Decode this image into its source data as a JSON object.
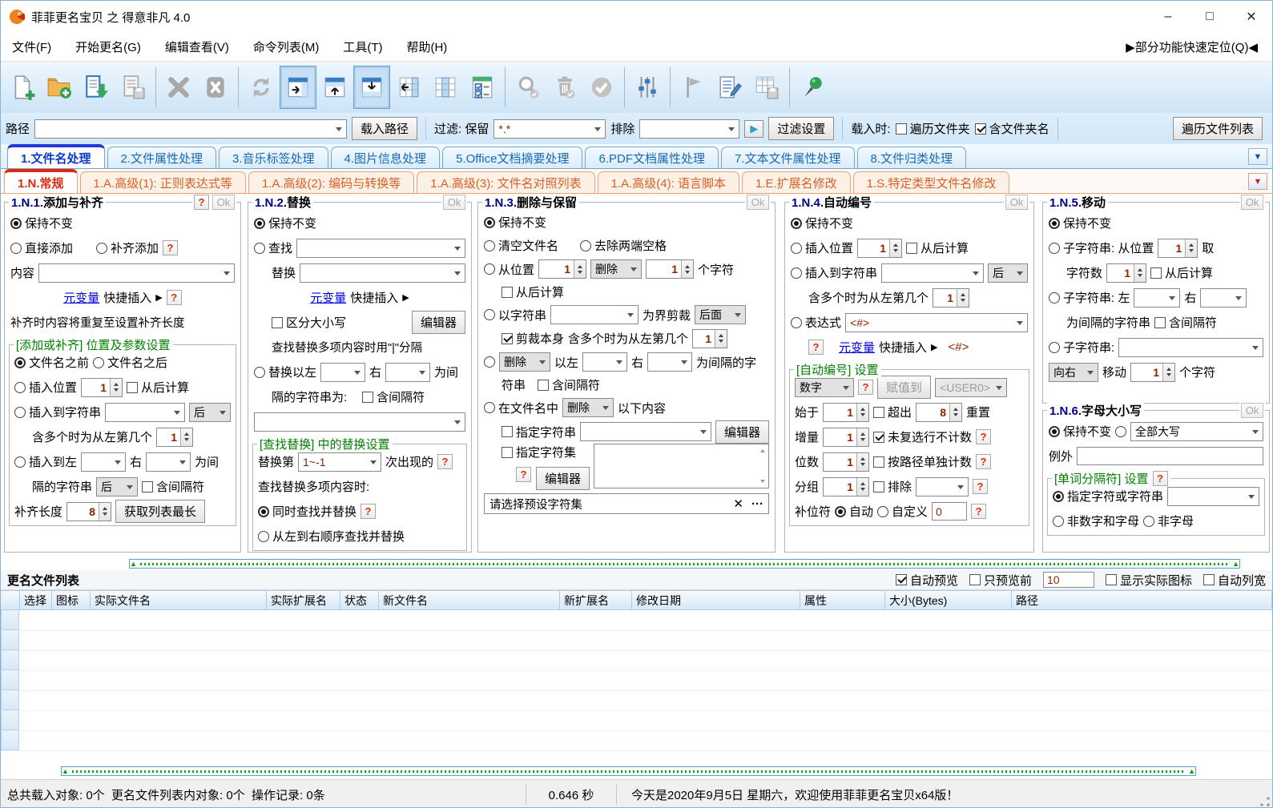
{
  "c": {
    "q": "?",
    "ok": "Ok",
    "keep": "保持不变",
    "from_end": "从后计算",
    "inc_sep": "含间隔符",
    "right": "右",
    "multi": "含多个时为从左第几个",
    "hou": "后",
    "editor": "编辑器",
    "metavar": "元变量",
    "quick_insert": "快捷插入",
    "arrow": "▶",
    "one": "1",
    "eight": "8",
    "del": "删除",
    "chars": "个字符"
  },
  "window": {
    "title": "菲菲更名宝贝 之 得意非凡 4.0",
    "min": "–",
    "max": "□",
    "close": "✕"
  },
  "menu": {
    "items": [
      "文件(F)",
      "开始更名(G)",
      "编辑查看(V)",
      "命令列表(M)",
      "工具(T)",
      "帮助(H)"
    ],
    "quick": "▶部分功能快速定位(Q)◀"
  },
  "toolbar": {
    "icons": [
      "new-file",
      "add-folder",
      "import-list",
      "save-list",
      "delete",
      "delete-all",
      "refresh",
      "panel-right",
      "panel-top",
      "panel-bottom",
      "columns-shift",
      "columns",
      "checklist",
      "search",
      "trash",
      "apply",
      "settings-sliders",
      "flag",
      "edit-list",
      "table-save",
      "pin"
    ]
  },
  "pathbar": {
    "path": "路径",
    "load": "载入路径",
    "filter": "过滤: 保留",
    "filter_val": "*.*",
    "exclude": "排除",
    "play": "▶",
    "filter_set": "过滤设置",
    "load_when": "载入时:",
    "walk": "遍历文件夹",
    "incl_folder": "含文件夹名",
    "walk_list": "遍历文件列表"
  },
  "tabs_main": [
    "1.文件名处理",
    "2.文件属性处理",
    "3.音乐标签处理",
    "4.图片信息处理",
    "5.Office文档摘要处理",
    "6.PDF文档属性处理",
    "7.文本文件属性处理",
    "8.文件归类处理"
  ],
  "tabs_sub": [
    "1.N.常规",
    "1.A.高级(1): 正则表达式等",
    "1.A.高级(2): 编码与转换等",
    "1.A.高级(3): 文件名对照列表",
    "1.A.高级(4): 语言脚本",
    "1.E.扩展名修改",
    "1.S.特定类型文件名修改"
  ],
  "tab_dd": "▼",
  "p1": {
    "num": "1.N.1.",
    "name": "添加与补齐",
    "add": "直接添加",
    "pad": "补齐添加",
    "content": "内容",
    "note": "补齐时内容将重复至设置补齐长度",
    "grp": "[添加或补齐] 位置及参数设置",
    "before": "文件名之前",
    "after": "文件名之后",
    "ins_pos": "插入位置",
    "ins_str": "插入到字符串",
    "ins_lr": "插入到左",
    "wei_jian": "为间",
    "sep_str": "隔的字符串",
    "pad_len": "补齐长度",
    "get_longest": "获取列表最长"
  },
  "p2": {
    "num": "1.N.2.",
    "name": "替换",
    "find": "查找",
    "repl": "替换",
    "case": "区分大小写",
    "tip": "查找替换多项内容时用\"|\"分隔",
    "repl_lr": "替换以左",
    "wei_jian": "为间",
    "sep_line": "隔的字符串为:",
    "grp": "[查找替换] 中的替换设置",
    "nth_pre": "替换第",
    "nth_val": "1~-1",
    "nth_post": "次出现的",
    "multi_tip": "查找替换多项内容时:",
    "simul": "同时查找并替换",
    "ltr": "从左到右顺序查找并替换"
  },
  "p3": {
    "num": "1.N.3.",
    "name": "删除与保留",
    "clear": "清空文件名",
    "trim": "去除两端空格",
    "from_pos": "从位置",
    "crop_by": "以字符串",
    "crop": "为界剪裁",
    "back": "后面",
    "crop_self": "剪裁本身",
    "yl": "以左",
    "sep1": "为间隔的字",
    "sep2": "符串",
    "in_name": "在文件名中",
    "following": "以下内容",
    "spec_str": "指定字符串",
    "spec_set": "指定字符集",
    "preset": "请选择预设字符集",
    "clear_x": "✕",
    "more": "···"
  },
  "p4": {
    "num": "1.N.4.",
    "name": "自动编号",
    "ins_pos": "插入位置",
    "ins_str": "插入到字符串",
    "expr": "表达式",
    "expr_val": "<#>",
    "expr_tag": "<#>",
    "grp": "[自动编号] 设置",
    "type_val": "数字",
    "assign": "赋值到",
    "user_val": "<USER0>",
    "start": "始于",
    "over": "超出",
    "reset": "重置",
    "inc": "增量",
    "uncount": "未复选行不计数",
    "digits": "位数",
    "per_path": "按路径单独计数",
    "group": "分组",
    "excl": "排除",
    "pad_char": "补位符",
    "auto": "自动",
    "custom": "自定义",
    "custom_val": "0"
  },
  "p5": {
    "num": "1.N.5.",
    "name": "移动",
    "sub1": "子字符串: 从位置",
    "take": "取",
    "chars_n": "字符数",
    "sub2": "子字符串: 左",
    "sep": "为间隔的字符串",
    "sub3": "子字符串:",
    "dir": "向右",
    "move": "移动"
  },
  "p6": {
    "num": "1.N.6.",
    "name": "字母大小写",
    "case_val": "全部大写",
    "except": "例外",
    "grp": "[单词分隔符] 设置",
    "spec": "指定字符或字符串",
    "non_alnum": "非数字和字母",
    "non_alpha": "非字母"
  },
  "filelist": {
    "title": "更名文件列表",
    "auto_preview": "自动预览",
    "preview_first": "只预览前",
    "preview_count": "10",
    "show_icons": "显示实际图标",
    "auto_width": "自动列宽",
    "columns": [
      "选择",
      "图标",
      "实际文件名",
      "实际扩展名",
      "状态",
      "新文件名",
      "新扩展名",
      "修改日期",
      "属性",
      "大小(Bytes)",
      "路径"
    ]
  },
  "statusbar": {
    "left": "总共载入对象: 0个  更名文件列表内对象: 0个  操作记录: 0条",
    "time": "0.646 秒",
    "right": "今天是2020年9月5日 星期六，欢迎使用菲菲更名宝贝x64版！"
  }
}
